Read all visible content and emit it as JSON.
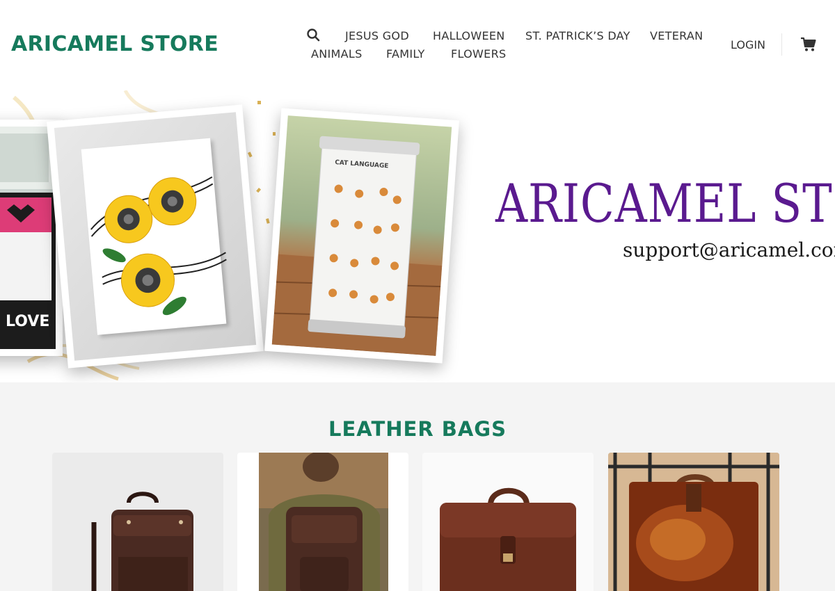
{
  "header": {
    "logo": "ARICAMEL STORE",
    "nav_row1": [
      "JESUS GOD",
      "HALLOWEEN",
      "ST. PATRICK’S DAY",
      "VETERAN"
    ],
    "nav_row2": [
      "ANIMALS",
      "FAMILY",
      "FLOWERS"
    ],
    "login_label": "LOGIN",
    "search_icon": "search-icon",
    "cart_icon": "cart-icon"
  },
  "hero": {
    "title": "ARICAMEL STORE",
    "email": "support@aricamel.com",
    "quilt_text": "LOVE",
    "tumbler_label": "CAT LANGUAGE"
  },
  "section": {
    "title": "LEATHER BAGS",
    "products": [
      "leather-backpack",
      "leather-backpack-worn",
      "leather-briefcase",
      "leather-tote"
    ]
  },
  "colors": {
    "brand_green": "#167a5c",
    "hero_purple": "#5a1a8f",
    "section_bg": "#f4f4f4"
  }
}
